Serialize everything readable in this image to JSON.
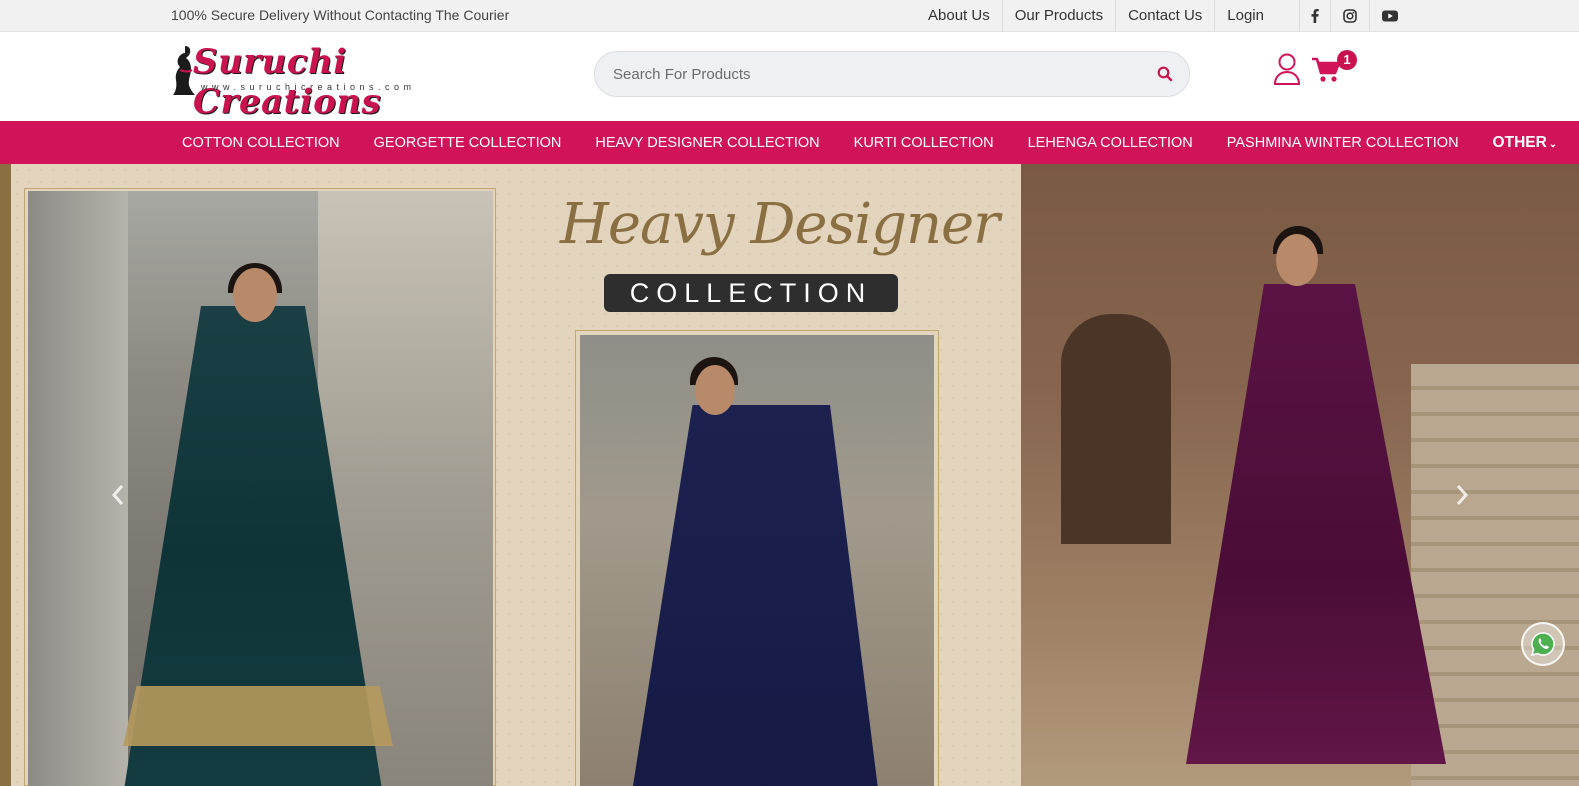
{
  "topbar": {
    "notice": "100% Secure Delivery Without Contacting The Courier",
    "links": [
      "About Us",
      "Our Products",
      "Contact Us",
      "Login"
    ],
    "socials": [
      "facebook-icon",
      "instagram-icon",
      "youtube-icon"
    ]
  },
  "header": {
    "brand": "Suruchi Creations",
    "url": "www.suruchicreations.com",
    "search_placeholder": "Search For Products",
    "cart_count": "1"
  },
  "nav": {
    "items": [
      "COTTON COLLECTION",
      "GEORGETTE COLLECTION",
      "HEAVY DESIGNER COLLECTION",
      "KURTI COLLECTION",
      "LEHENGA COLLECTION",
      "PASHMINA WINTER COLLECTION"
    ],
    "other": "OTHER"
  },
  "banner": {
    "title": "Heavy Designer",
    "subtitle": "COLLECTION"
  },
  "colors": {
    "brand": "#d1145a",
    "gold": "#8a6f43",
    "topbar": "#f1f1f1"
  }
}
